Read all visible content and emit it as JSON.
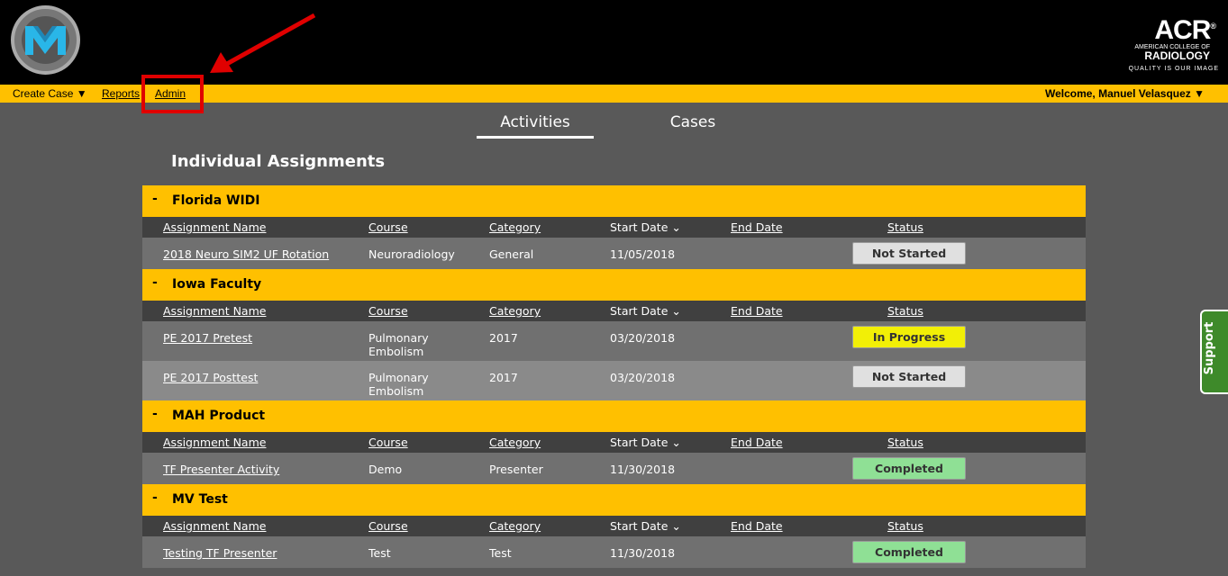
{
  "header": {
    "acr_logo": "ACR",
    "acr_registered": "®",
    "acr_sub1": "AMERICAN COLLEGE OF",
    "acr_sub2": "RADIOLOGY",
    "acr_tagline": "QUALITY IS OUR IMAGE"
  },
  "nav": {
    "create_case": "Create Case ▼",
    "reports": "Reports",
    "admin": "Admin",
    "welcome": "Welcome, Manuel Velasquez ▼"
  },
  "tabs": {
    "activities": "Activities",
    "cases": "Cases"
  },
  "section_title": "Individual Assignments",
  "columns": {
    "name": "Assignment Name",
    "course": "Course",
    "category": "Category",
    "start": "Start Date ⌄",
    "end": "End Date",
    "status": "Status"
  },
  "groups": [
    {
      "minus": "-",
      "name": "Florida WIDI",
      "rows": [
        {
          "name": "2018 Neuro SIM2 UF Rotation",
          "course": "Neuroradiology",
          "category": "General",
          "start": "11/05/2018",
          "end": "",
          "status": "Not Started"
        }
      ]
    },
    {
      "minus": "-",
      "name": "Iowa Faculty",
      "rows": [
        {
          "name": "PE 2017 Pretest",
          "course_line1": "Pulmonary",
          "course_line2": "Embolism",
          "category": "2017",
          "start": "03/20/2018",
          "end": "",
          "status": "In Progress"
        },
        {
          "name": "PE 2017 Posttest",
          "course_line1": "Pulmonary",
          "course_line2": "Embolism",
          "category": "2017",
          "start": "03/20/2018",
          "end": "",
          "status": "Not Started"
        }
      ]
    },
    {
      "minus": "-",
      "name": "MAH Product",
      "rows": [
        {
          "name": "TF Presenter Activity",
          "course": "Demo",
          "category": "Presenter",
          "start": "11/30/2018",
          "end": "",
          "status": "Completed"
        }
      ]
    },
    {
      "minus": "-",
      "name": "MV Test",
      "rows": [
        {
          "name": "Testing TF Presenter",
          "course": "Test",
          "category": "Test",
          "start": "11/30/2018",
          "end": "",
          "status": "Completed"
        }
      ]
    }
  ],
  "support": "Support",
  "colors": {
    "accent_yellow": "#ffc000",
    "annotation_red": "#e00000",
    "completed_green": "#8fe095",
    "in_progress_yellow": "#f2ef06",
    "support_green": "#3e8a2a"
  }
}
